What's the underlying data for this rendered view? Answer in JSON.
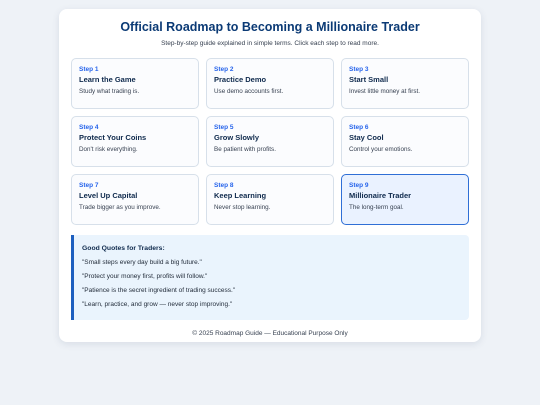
{
  "header": {
    "title": "Official Roadmap to Becoming a Millionaire Trader",
    "subtitle": "Step-by-step guide explained in simple terms. Click each step to read more."
  },
  "steps": [
    {
      "num": "Step 1",
      "title": "Learn the Game",
      "desc": "Study what trading is."
    },
    {
      "num": "Step 2",
      "title": "Practice Demo",
      "desc": "Use demo accounts first."
    },
    {
      "num": "Step 3",
      "title": "Start Small",
      "desc": "Invest little money at first."
    },
    {
      "num": "Step 4",
      "title": "Protect Your Coins",
      "desc": "Don't risk everything."
    },
    {
      "num": "Step 5",
      "title": "Grow Slowly",
      "desc": "Be patient with profits."
    },
    {
      "num": "Step 6",
      "title": "Stay Cool",
      "desc": "Control your emotions."
    },
    {
      "num": "Step 7",
      "title": "Level Up Capital",
      "desc": "Trade bigger as you improve."
    },
    {
      "num": "Step 8",
      "title": "Keep Learning",
      "desc": "Never stop learning."
    },
    {
      "num": "Step 9",
      "title": "Millionaire Trader",
      "desc": "The long-term goal."
    }
  ],
  "quotes": {
    "title": "Good Quotes for Traders:",
    "items": [
      "\"Small steps every day build a big future.\"",
      "\"Protect your money first, profits will follow.\"",
      "\"Patience is the secret ingredient of trading success.\"",
      "\"Learn, practice, and grow — never stop improving.\""
    ]
  },
  "footer": {
    "text": "© 2025 Roadmap Guide — Educational Purpose Only"
  },
  "colors": {
    "accent": "#2563eb",
    "title": "#0b3a75",
    "active_border": "#2f6fd6",
    "active_bg": "#eaf2ff"
  }
}
